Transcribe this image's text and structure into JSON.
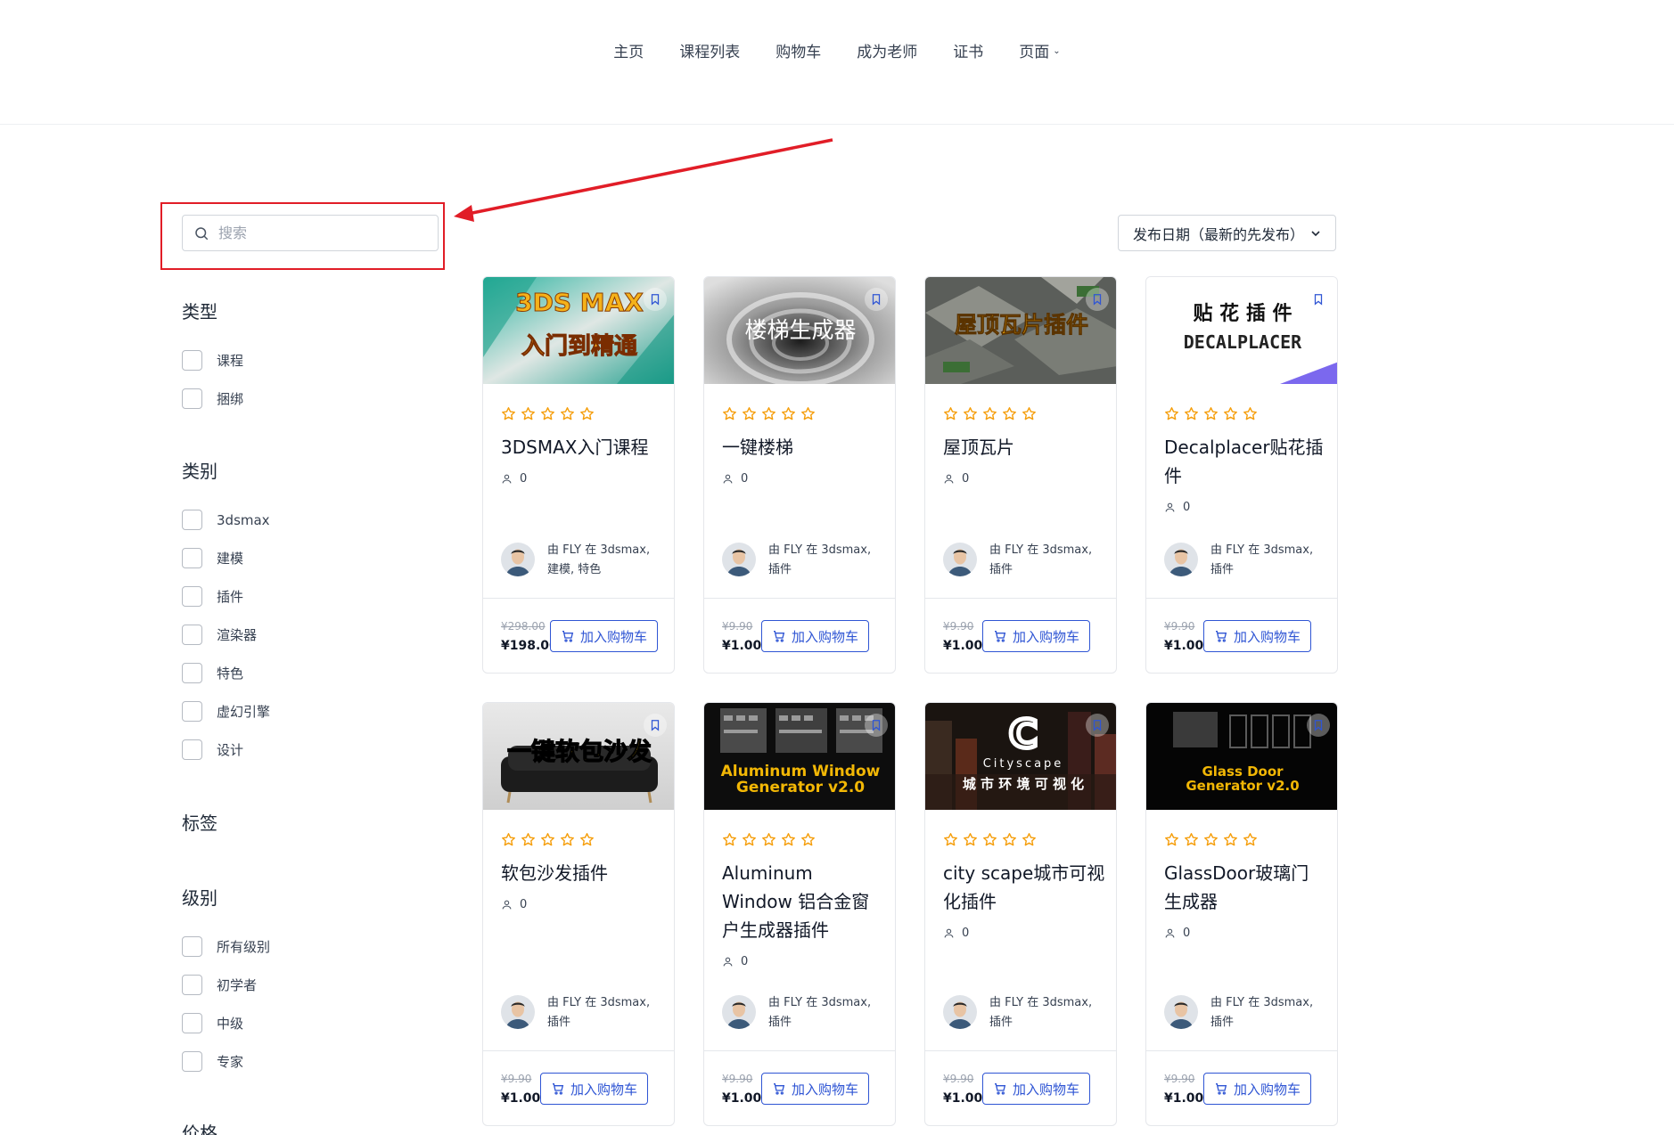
{
  "nav": {
    "items": [
      "主页",
      "课程列表",
      "购物车",
      "成为老师",
      "证书",
      "页面"
    ]
  },
  "search": {
    "placeholder": "搜索",
    "value": ""
  },
  "sort": {
    "selected": "发布日期（最新的先发布）"
  },
  "filters": {
    "type": {
      "title": "类型",
      "options": [
        "课程",
        "捆绑"
      ]
    },
    "category": {
      "title": "类别",
      "options": [
        "3dsmax",
        "建模",
        "插件",
        "渲染器",
        "特色",
        "虚幻引擎",
        "设计"
      ]
    },
    "tags": {
      "title": "标签"
    },
    "level": {
      "title": "级别",
      "options": [
        "所有级别",
        "初学者",
        "中级",
        "专家"
      ]
    },
    "price": {
      "title": "价格"
    }
  },
  "cart_label": "加入购物车",
  "courses": [
    {
      "title": "3DSMAX入门课程",
      "students": "0",
      "author": "由 FLY 在 3dsmax, 建模, 特色",
      "price_old": "¥298.00",
      "price_new": "¥198.00",
      "thumb_text": [
        "3DS MAX",
        "入门到精通"
      ]
    },
    {
      "title": "一键楼梯",
      "students": "0",
      "author": "由 FLY 在 3dsmax, 插件",
      "price_old": "¥9.90",
      "price_new": "¥1.00",
      "thumb_text": [
        "楼梯生成器"
      ]
    },
    {
      "title": "屋顶瓦片",
      "students": "0",
      "author": "由 FLY 在 3dsmax, 插件",
      "price_old": "¥9.90",
      "price_new": "¥1.00",
      "thumb_text": [
        "屋顶瓦片插件"
      ]
    },
    {
      "title": "Decalplacer贴花插件",
      "students": "0",
      "author": "由 FLY 在 3dsmax, 插件",
      "price_old": "¥9.90",
      "price_new": "¥1.00",
      "thumb_text": [
        "贴 花 插 件",
        "DECALPLACER"
      ]
    },
    {
      "title": "软包沙发插件",
      "students": "0",
      "author": "由 FLY 在 3dsmax, 插件",
      "price_old": "¥9.90",
      "price_new": "¥1.00",
      "thumb_text": [
        "一键软包沙发"
      ]
    },
    {
      "title": "Aluminum Window 铝合金窗户生成器插件",
      "students": "0",
      "author": "由 FLY 在 3dsmax, 插件",
      "price_old": "¥9.90",
      "price_new": "¥1.00",
      "thumb_text": [
        "Aluminum Window",
        "Generator v2.0"
      ]
    },
    {
      "title": "city scape城市可视化插件",
      "students": "0",
      "author": "由 FLY 在 3dsmax, 插件",
      "price_old": "¥9.90",
      "price_new": "¥1.00",
      "thumb_text": [
        "C",
        "Cityscape",
        "城 市 环 境 可 视 化"
      ]
    },
    {
      "title": "GlassDoor玻璃门生成器",
      "students": "0",
      "author": "由 FLY 在 3dsmax, 插件",
      "price_old": "¥9.90",
      "price_new": "¥1.00",
      "thumb_text": [
        "Glass Door",
        "Generator v2.0"
      ]
    }
  ],
  "colors": {
    "accent": "#2f55d4",
    "star": "#f59e0b",
    "annotation": "#e11d27"
  }
}
